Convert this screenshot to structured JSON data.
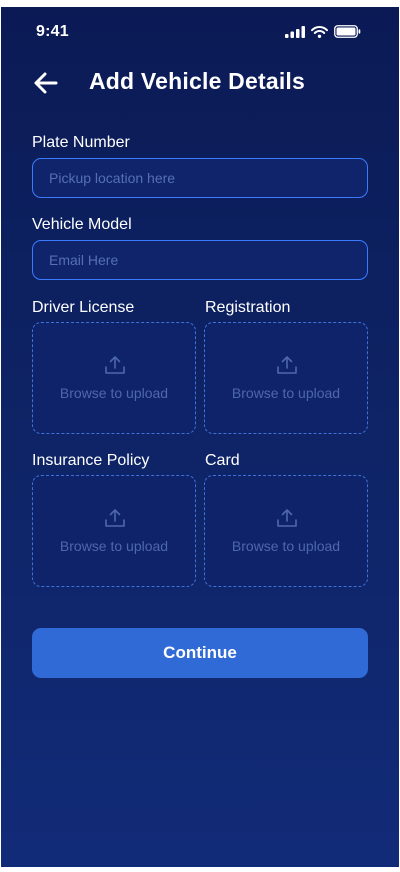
{
  "status_bar": {
    "time": "9:41",
    "icons": [
      "cellular-signal-icon",
      "wifi-icon",
      "battery-icon"
    ]
  },
  "header": {
    "back_icon": "arrow-left-icon",
    "title": "Add Vehicle Details"
  },
  "form": {
    "plate_number": {
      "label": "Plate Number",
      "value": "",
      "placeholder": "Pickup location here"
    },
    "vehicle_model": {
      "label": "Vehicle Model",
      "value": "",
      "placeholder": "Email Here"
    },
    "uploads": [
      {
        "label": "Driver License",
        "text": "Browse to upload",
        "icon": "upload-icon"
      },
      {
        "label": "Registration",
        "text": "Browse to upload",
        "icon": "upload-icon"
      },
      {
        "label": "Insurance Policy",
        "text": "Browse to upload",
        "icon": "upload-icon"
      },
      {
        "label": "Card",
        "text": "Browse to upload",
        "icon": "upload-icon"
      }
    ]
  },
  "continue_label": "Continue",
  "colors": {
    "background_top": "#0b1a55",
    "background_bottom": "#122b78",
    "input_border": "#3a7bff",
    "upload_border": "#3f71d6",
    "button": "#2f6ad6",
    "placeholder": "#5670b4"
  }
}
